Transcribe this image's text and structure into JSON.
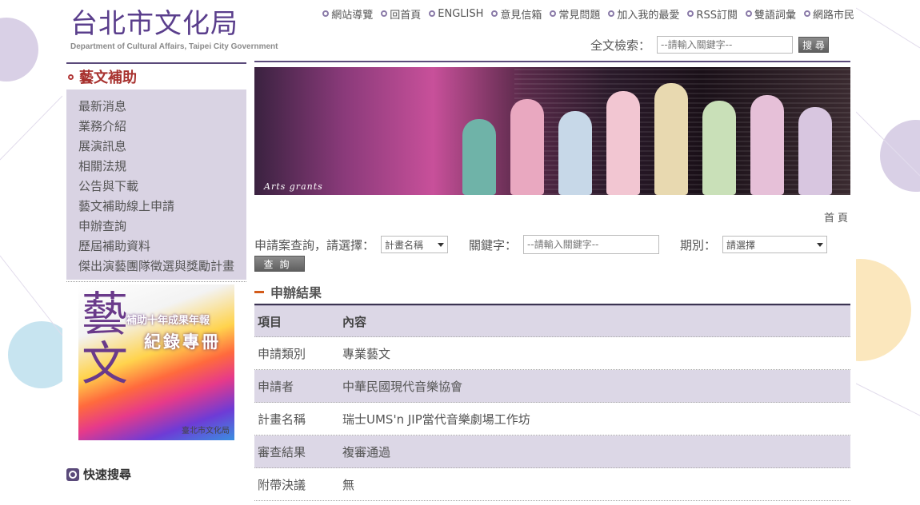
{
  "header": {
    "logo_title": "台北市文化局",
    "logo_subtitle": "Department of Cultural Affairs, Taipei City Government",
    "nav": [
      "網站導覽",
      "回首頁",
      "ENGLISH",
      "意見信箱",
      "常見問題",
      "加入我的最愛",
      "RSS訂閱",
      "雙語詞彙",
      "網路市民"
    ],
    "search_label": "全文檢索：",
    "search_placeholder": "--請輸入關鍵字--",
    "search_button": "搜 尋"
  },
  "sidebar": {
    "title": "藝文補助",
    "items": [
      "最新消息",
      "業務介紹",
      "展演訊息",
      "相關法規",
      "公告與下載",
      "藝文補助線上申請",
      "申辦查詢",
      "歷屆補助資料",
      "傑出演藝團隊徵選與獎勵計畫"
    ],
    "promo": {
      "big_char": "藝文",
      "line1": "補助十年成果年報",
      "line2": "紀錄專冊",
      "line3": "臺北市文化局"
    },
    "quick_search": "快速搜尋"
  },
  "banner": {
    "caption": "Arts grants"
  },
  "breadcrumb": "首頁",
  "query": {
    "label": "申請案查詢，請選擇：",
    "select_value": "計畫名稱",
    "keyword_label": "關鍵字：",
    "keyword_placeholder": "--請輸入關鍵字--",
    "period_label": "期別：",
    "period_value": "請選擇",
    "button": "查詢"
  },
  "results": {
    "title": "申辦結果",
    "headers": [
      "項目",
      "內容"
    ],
    "rows": [
      [
        "申請類別",
        "專業藝文"
      ],
      [
        "申請者",
        "中華民國現代音樂協會"
      ],
      [
        "計畫名稱",
        "瑞士UMS'n JIP當代音樂劇場工作坊"
      ],
      [
        "審查結果",
        "複審通過"
      ],
      [
        "附帶決議",
        "無"
      ]
    ]
  }
}
